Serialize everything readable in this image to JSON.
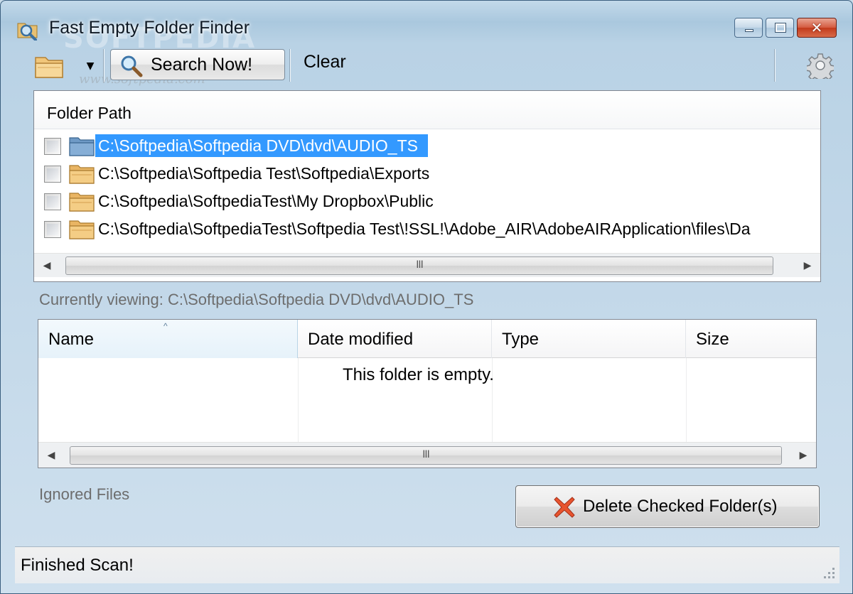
{
  "window": {
    "title": "Fast Empty Folder Finder",
    "watermark": "SOFTPEDIA",
    "watermark_url": "www.softpedia.com"
  },
  "toolbar": {
    "folder_icon": "folder-icon",
    "dropdown_icon": "chevron-down-icon",
    "search_label": "Search Now!",
    "clear_label": "Clear",
    "settings_icon": "gear-icon"
  },
  "folder_list": {
    "header": "Folder Path",
    "rows": [
      {
        "path": "C:\\Softpedia\\Softpedia DVD\\dvd\\AUDIO_TS",
        "checked": false,
        "selected": true
      },
      {
        "path": "C:\\Softpedia\\Softpedia Test\\Softpedia\\Exports",
        "checked": false,
        "selected": false
      },
      {
        "path": "C:\\Softpedia\\SoftpediaTest\\My Dropbox\\Public",
        "checked": false,
        "selected": false
      },
      {
        "path": "C:\\Softpedia\\SoftpediaTest\\Softpedia Test\\!SSL!\\Adobe_AIR\\AdobeAIRApplication\\files\\Da",
        "checked": false,
        "selected": false
      }
    ],
    "scroll_grip": "III"
  },
  "current_view": {
    "text": "Currently viewing: C:\\Softpedia\\Softpedia DVD\\dvd\\AUDIO_TS"
  },
  "explorer": {
    "columns": [
      "Name",
      "Date modified",
      "Type",
      "Size"
    ],
    "sort_indicator": "^",
    "empty_message": "This folder is empty.",
    "scroll_grip": "III"
  },
  "footer": {
    "ignored_label": "Ignored Files",
    "delete_label": "Delete Checked Folder(s)"
  },
  "status": {
    "text": "Finished Scan!"
  },
  "colors": {
    "selection": "#3399ff",
    "close_button": "#c23a1c",
    "secondary_text": "#6d6d6d"
  }
}
